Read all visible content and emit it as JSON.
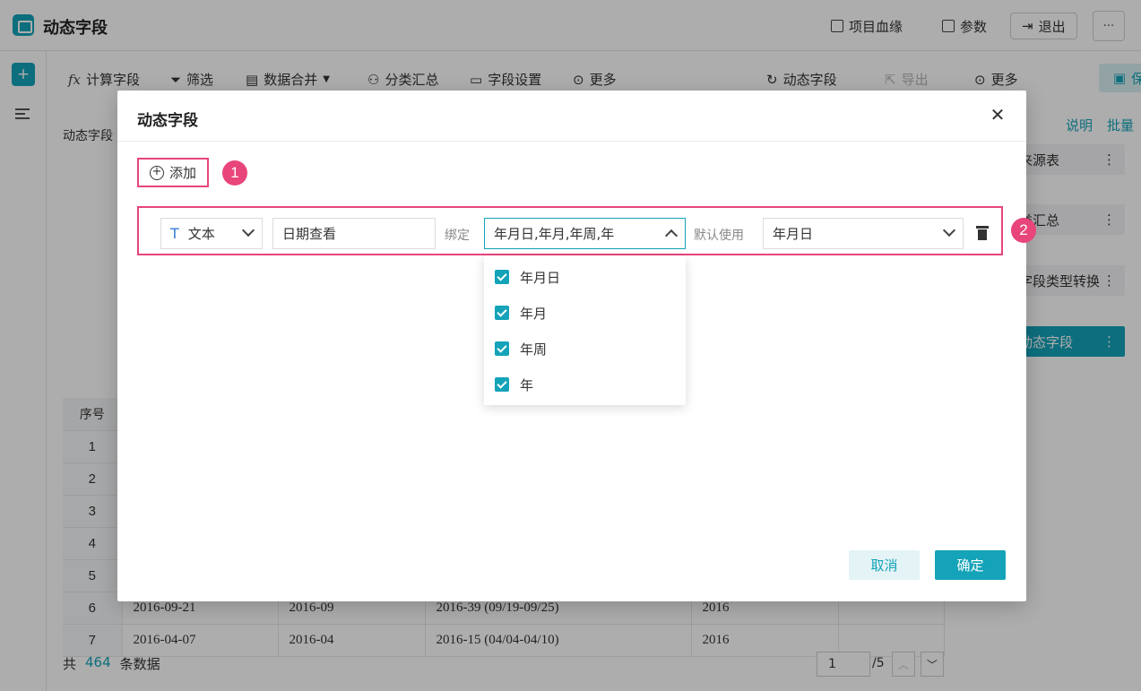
{
  "app": {
    "title": "动态字段"
  },
  "header": {
    "lineage": "项目血缘",
    "params": "参数",
    "exit": "退出",
    "more": "···"
  },
  "toolbar": {
    "calc": "计算字段",
    "filter": "筛选",
    "merge": "数据合并",
    "group": "分类汇总",
    "field_settings": "字段设置",
    "more_left": "更多",
    "dynamic": "动态字段",
    "export": "导出",
    "more_right": "更多",
    "save": "保存"
  },
  "content": {
    "label": "动态字段"
  },
  "table": {
    "header": [
      "序号",
      "",
      "",
      "",
      "",
      ""
    ],
    "rows": [
      [
        "1",
        "",
        "",
        "",
        "",
        ""
      ],
      [
        "2",
        "",
        "",
        "",
        "",
        ""
      ],
      [
        "3",
        "",
        "",
        "",
        "",
        ""
      ],
      [
        "4",
        "",
        "",
        "",
        "",
        ""
      ],
      [
        "5",
        "",
        "",
        "",
        "",
        ""
      ],
      [
        "6",
        "2016-09-21",
        "2016-09",
        "2016-39 (09/19-09/25)",
        "2016",
        ""
      ],
      [
        "7",
        "2016-04-07",
        "2016-04",
        "2016-15 (04/04-04/10)",
        "2016",
        ""
      ]
    ]
  },
  "footer": {
    "prefix": "共",
    "count": "464",
    "suffix": "条数据"
  },
  "pager": {
    "page": "1",
    "total": "/5"
  },
  "right_panel": {
    "link_help": "说明",
    "link_batch": "批量",
    "items": [
      {
        "label": "来源表"
      },
      {
        "label": "类汇总"
      },
      {
        "label": "字段类型转换"
      },
      {
        "label": "动态字段"
      }
    ]
  },
  "dialog": {
    "title": "动态字段",
    "add_label": "添加",
    "badge1": "1",
    "badge2": "2",
    "type": "文本",
    "name_value": "日期查看",
    "bind_label": "绑定",
    "bind_value": "年月日,年月,年周,年",
    "default_label": "默认使用",
    "default_value": "年月日",
    "options": [
      "年月日",
      "年月",
      "年周",
      "年"
    ],
    "cancel": "取消",
    "ok": "确定"
  }
}
